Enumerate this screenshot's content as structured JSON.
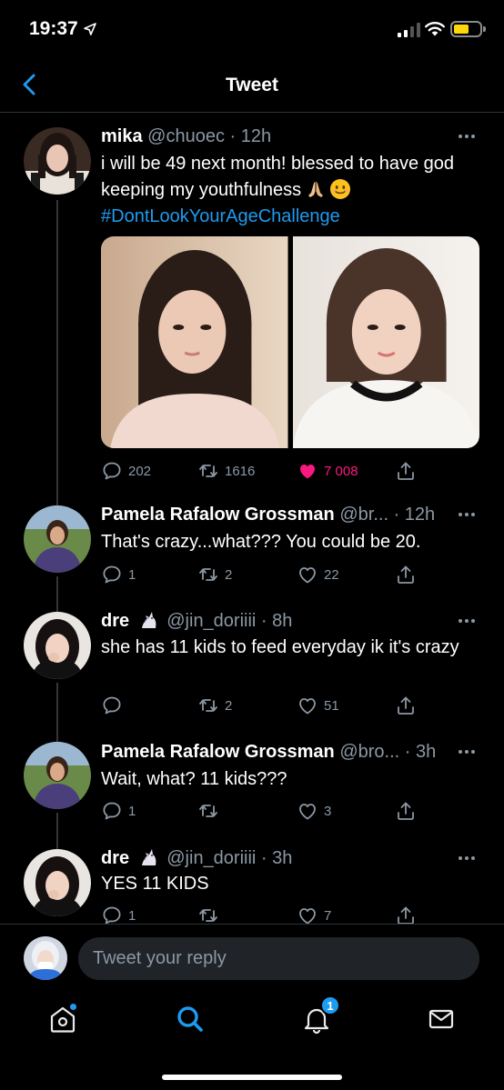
{
  "status_bar": {
    "time": "19:37"
  },
  "header": {
    "title": "Tweet"
  },
  "main_tweet": {
    "name": "mika",
    "handle": "@chuoec",
    "time": "12h",
    "text": "i will be 49 next month! blessed to have god keeping my youthfulness",
    "hashtag": "#DontLookYourAgeChallenge",
    "replies": "202",
    "retweets": "1616",
    "likes": "7 008"
  },
  "replies": [
    {
      "name": "Pamela Rafalow Grossman",
      "handle": "@br...",
      "time": "12h",
      "text": "That's crazy...what??? You could be 20.",
      "replies": "1",
      "retweets": "2",
      "likes": "22"
    },
    {
      "name": "dre",
      "handle": "@jin_doriiii",
      "time": "8h",
      "text": "she has 11 kids to feed everyday ik it's crazy",
      "replies": "",
      "retweets": "2",
      "likes": "51"
    },
    {
      "name": "Pamela Rafalow Grossman",
      "handle": "@bro...",
      "time": "3h",
      "text": "Wait, what? 11 kids???",
      "replies": "1",
      "retweets": "",
      "likes": "3"
    },
    {
      "name": "dre",
      "handle": "@jin_doriiii",
      "time": "3h",
      "text": "YES 11 KIDS",
      "replies": "1",
      "retweets": "",
      "likes": "7"
    }
  ],
  "reply_bar": {
    "placeholder": "Tweet your reply"
  },
  "tab_bar": {
    "notifications_badge": "1"
  },
  "colors": {
    "accent": "#1d9bf0",
    "like": "#f91880",
    "background": "#000000",
    "muted": "#8b98a5"
  },
  "icons": [
    "back-chevron-icon",
    "reply-icon",
    "retweet-icon",
    "like-icon",
    "share-icon",
    "home-icon",
    "search-icon",
    "notifications-icon",
    "messages-icon"
  ]
}
